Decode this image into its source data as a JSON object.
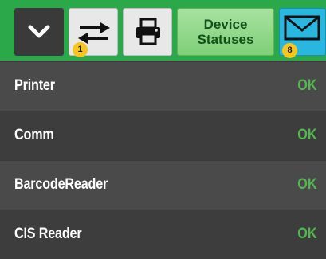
{
  "toolbar": {
    "device_statuses_label": "Device\nStatuses",
    "exchange_badge": "1",
    "messages_badge": "8",
    "colors": {
      "bar": "#2aa84a",
      "badge": "#f6c51f",
      "messages_button": "#29b6df"
    },
    "icons": [
      "chevron-down-icon",
      "exchange-arrows-icon",
      "printer-icon",
      "envelope-icon"
    ]
  },
  "devices": [
    {
      "name": "Printer",
      "status": "OK"
    },
    {
      "name": "Comm",
      "status": "OK"
    },
    {
      "name": "BarcodeReader",
      "status": "OK"
    },
    {
      "name": "CIS Reader",
      "status": "OK"
    }
  ],
  "status_color": "#52b74f"
}
